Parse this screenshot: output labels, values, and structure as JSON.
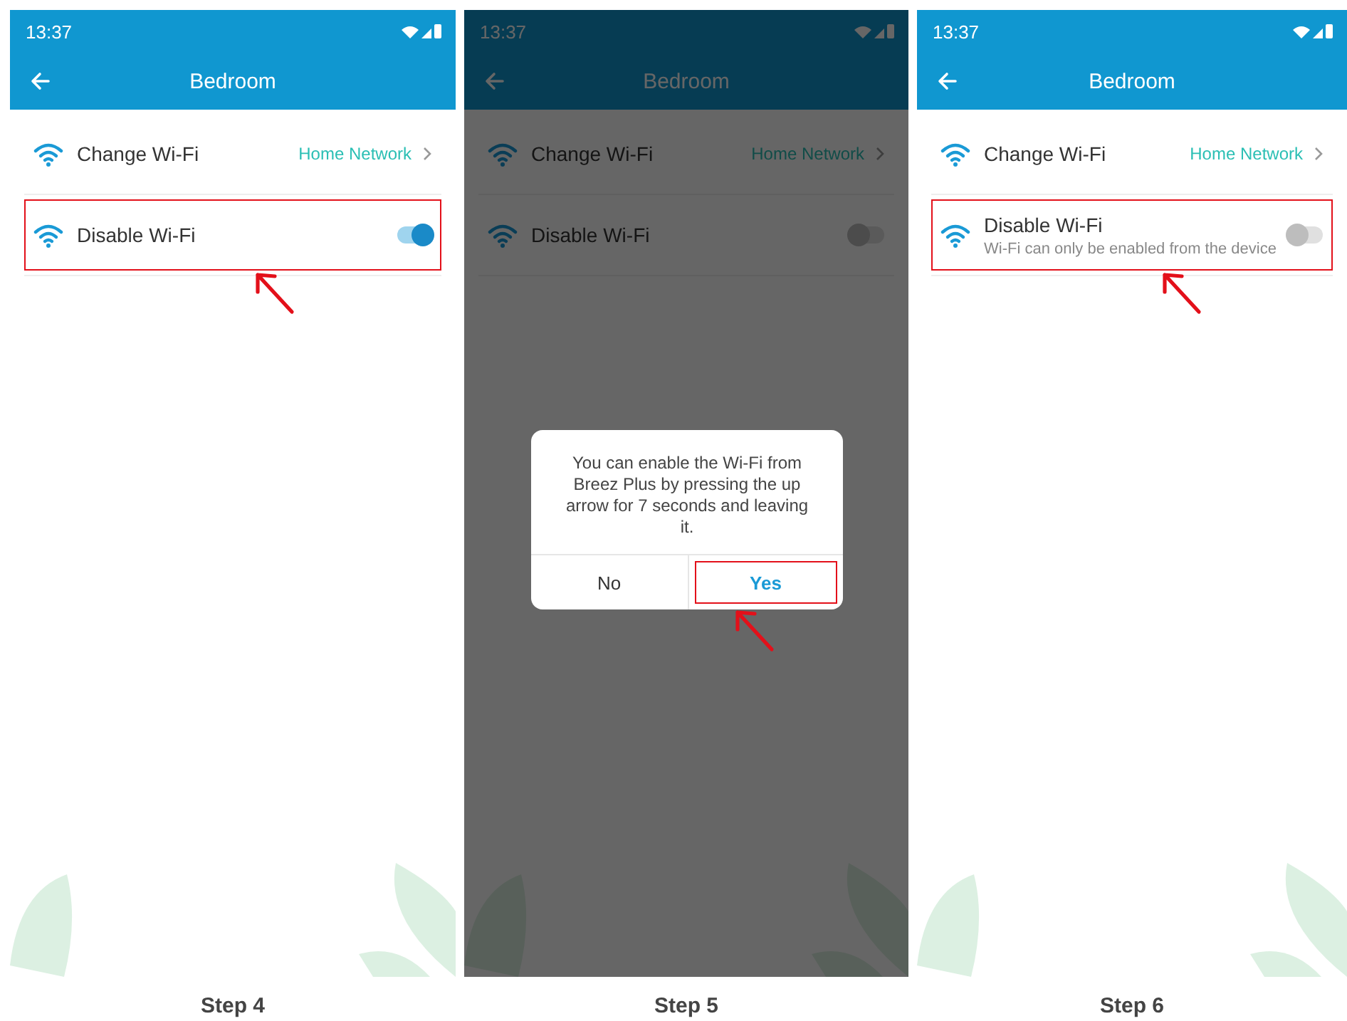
{
  "screens": [
    {
      "time": "13:37",
      "title": "Bedroom",
      "dimmed": false,
      "rows": [
        {
          "kind": "link",
          "label": "Change Wi-Fi",
          "value": "Home Network",
          "highlighted": false
        },
        {
          "kind": "toggle",
          "label": "Disable Wi-Fi",
          "on": true,
          "highlighted": true
        }
      ],
      "caption": "Step 4"
    },
    {
      "time": "13:37",
      "title": "Bedroom",
      "dimmed": true,
      "rows": [
        {
          "kind": "link",
          "label": "Change Wi-Fi",
          "value": "Home Network",
          "highlighted": false
        },
        {
          "kind": "toggle",
          "label": "Disable Wi-Fi",
          "on": false,
          "highlighted": false
        }
      ],
      "dialog": {
        "message": "You can enable the Wi-Fi from Breez Plus by pressing the up arrow for 7 seconds and leaving it.",
        "buttons": [
          {
            "label": "No",
            "highlighted": false
          },
          {
            "label": "Yes",
            "highlighted": true
          }
        ]
      },
      "caption": "Step 5"
    },
    {
      "time": "13:37",
      "title": "Bedroom",
      "dimmed": false,
      "rows": [
        {
          "kind": "link",
          "label": "Change Wi-Fi",
          "value": "Home Network",
          "highlighted": false
        },
        {
          "kind": "toggle",
          "label": "Disable Wi-Fi",
          "subtitle": "Wi-Fi can only be enabled from the device",
          "on": false,
          "highlighted": true
        }
      ],
      "caption": "Step 6"
    }
  ]
}
